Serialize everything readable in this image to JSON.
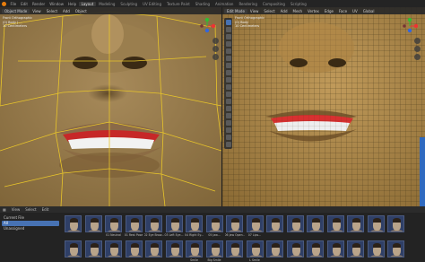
{
  "topbar": {
    "menus": [
      "File",
      "Edit",
      "Render",
      "Window",
      "Help"
    ],
    "tabs": [
      "Layout",
      "Modeling",
      "Sculpting",
      "UV Editing",
      "Texture Paint",
      "Shading",
      "Animation",
      "Rendering",
      "Compositing",
      "Scripting"
    ],
    "active_tab_index": 0
  },
  "left_view": {
    "mode": "Object Mode",
    "menus": [
      "View",
      "Select",
      "Add",
      "Object"
    ],
    "overlay_lines": [
      "Front Orthographic",
      "(0) Body | ...",
      "10 Centimeters"
    ]
  },
  "right_view": {
    "mode": "Edit Mode",
    "menus": [
      "View",
      "Select",
      "Add",
      "Mesh",
      "Vertex",
      "Edge",
      "Face",
      "UV"
    ],
    "overlay_lines": [
      "Front Orthographic",
      "(0) Body",
      "10 Centimeters"
    ],
    "transform": "Global"
  },
  "asset_browser": {
    "menus": [
      "View",
      "Select",
      "Edit"
    ],
    "library": "Current File",
    "catalogs": [
      "All",
      "Unassigned"
    ],
    "selected_catalog": 0,
    "row1_labels": [
      "",
      "",
      "01 Neutral",
      "01 Rest Pose",
      "02 Eye Brow...",
      "03 Left Eye...",
      "04 Right Ey...",
      "05 Jaw...",
      "06 Jaw Open...",
      "07 Lips...",
      "",
      "",
      "",
      "",
      "",
      "",
      "",
      "",
      "",
      ""
    ],
    "row2_labels": [
      "",
      "",
      "",
      "",
      "",
      "",
      "Smile",
      "Big Smile",
      "",
      "L Smile",
      "",
      "",
      "",
      "",
      "",
      "",
      "",
      "",
      "",
      ""
    ]
  }
}
